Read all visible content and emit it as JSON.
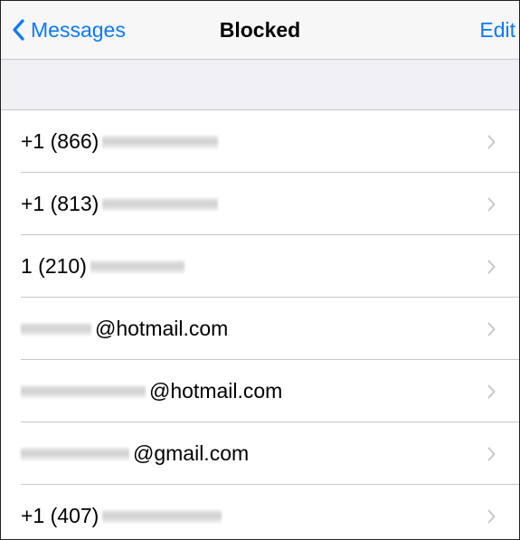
{
  "navbar": {
    "back_label": "Messages",
    "title": "Blocked",
    "edit_label": "Edit"
  },
  "colors": {
    "accent": "#0a7aff",
    "navbar_bg": "#f7f7f7",
    "section_bg": "#efeff4",
    "separator": "#c8c7cc",
    "chevron": "#c7c7cc"
  },
  "icons": {
    "back": "chevron-left-icon",
    "disclosure": "chevron-right-icon"
  },
  "blocked": [
    {
      "text": "+1 (866)",
      "redacted": "after"
    },
    {
      "text": "+1 (813)",
      "redacted": "after"
    },
    {
      "text": "1 (210)",
      "redacted": "after"
    },
    {
      "text": "@hotmail.com",
      "redacted": "before"
    },
    {
      "text": "@hotmail.com",
      "redacted": "before"
    },
    {
      "text": "@gmail.com",
      "redacted": "before"
    },
    {
      "text": "+1 (407)",
      "redacted": "after"
    }
  ]
}
